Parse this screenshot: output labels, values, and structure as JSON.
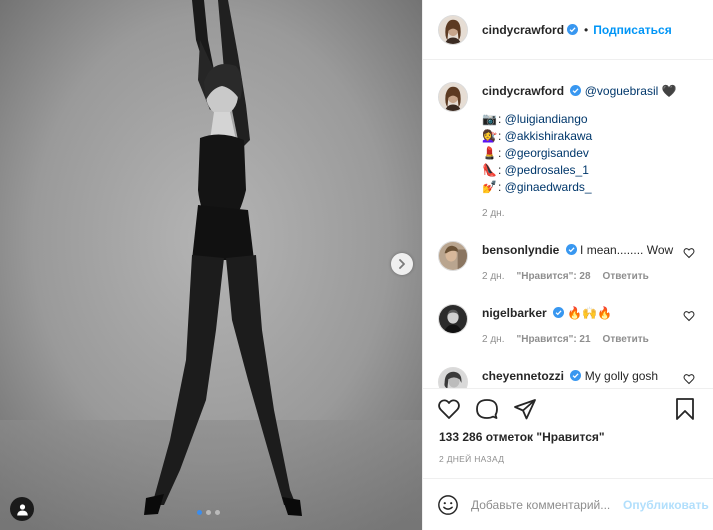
{
  "author": {
    "username": "cindycrawford",
    "verified": true,
    "separator": "•",
    "follow_label": "Подписаться"
  },
  "caption": {
    "username": "cindycrawford",
    "mention": "@voguebrasil",
    "heart": "🖤",
    "credits": [
      {
        "emoji": "📷",
        "prefix": ": ",
        "handle": "@luigiandiango"
      },
      {
        "emoji": "💇‍♀️",
        "prefix": ": ",
        "handle": "@akkishirakawa"
      },
      {
        "emoji": "💄",
        "prefix": ": ",
        "handle": "@georgisandev"
      },
      {
        "emoji": "👠",
        "prefix": ": ",
        "handle": "@pedrosales_1"
      },
      {
        "emoji": "💅",
        "prefix": ": ",
        "handle": "@ginaedwards_"
      }
    ],
    "time": "2 дн."
  },
  "comments": [
    {
      "username": "bensonlyndie",
      "verified": true,
      "text": "I mean........ Wow",
      "time": "2 дн.",
      "likes": "\"Нравится\": 28",
      "reply": "Ответить"
    },
    {
      "username": "nigelbarker",
      "verified": true,
      "text": "🔥🙌🔥",
      "time": "2 дн.",
      "likes": "\"Нравится\": 21",
      "reply": "Ответить"
    },
    {
      "username": "cheyennetozzi",
      "verified": true,
      "text": "My golly gosh",
      "text2": "😍😎"
    }
  ],
  "stats": {
    "likes_text": "133 286 отметок \"Нравится\"",
    "date_text": "2 ДНЕЙ НАЗАД"
  },
  "add_comment": {
    "placeholder": "Добавьте комментарий...",
    "publish_label": "Опубликовать"
  },
  "carousel": {
    "count": 3,
    "active_index": 0
  },
  "colors": {
    "accent": "#0095f6",
    "verified": "#3897f0",
    "muted": "#8e8e8e",
    "publish_disabled": "#b2dffc"
  },
  "icons": [
    "chevron-right-icon",
    "user-tag-icon",
    "heart-icon",
    "comment-icon",
    "share-icon",
    "bookmark-icon",
    "smile-icon",
    "verified-icon"
  ]
}
